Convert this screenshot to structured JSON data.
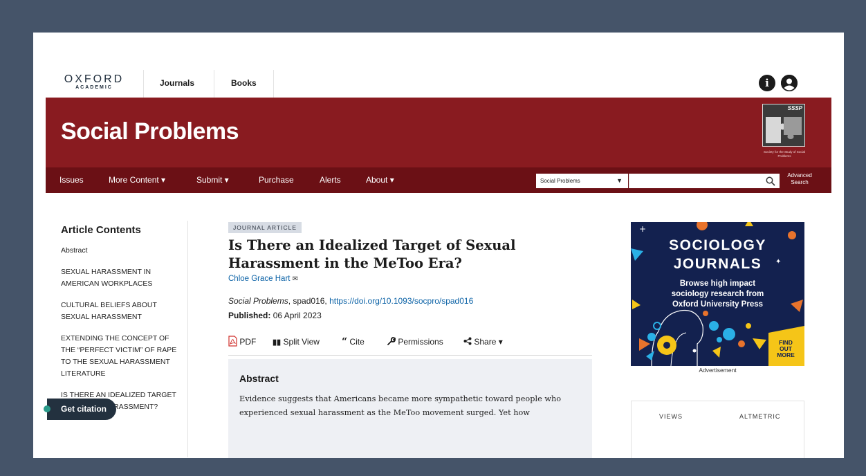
{
  "header": {
    "logo_line1": "OXFORD",
    "logo_line2": "ACADEMIC",
    "tabs": [
      {
        "label": "Journals"
      },
      {
        "label": "Books"
      }
    ],
    "info_icon": "info-icon",
    "account_icon": "account-icon"
  },
  "banner": {
    "journal_title": "Social Problems",
    "society_logo_text": "SSSP",
    "society_caption": "Society for the Study of Social Problems",
    "color": "#891b20"
  },
  "nav": {
    "items": [
      {
        "label": "Issues"
      },
      {
        "label": "More Content ▾"
      },
      {
        "label": "Submit ▾"
      },
      {
        "label": "Purchase"
      },
      {
        "label": "Alerts"
      },
      {
        "label": "About ▾"
      }
    ],
    "search_scope": "Social Problems",
    "search_placeholder": "",
    "advanced_search": "Advanced Search",
    "color": "#6b1015"
  },
  "sidebar": {
    "title": "Article Contents",
    "items": [
      {
        "label": "Abstract"
      },
      {
        "label": "SEXUAL HARASSMENT IN AMERICAN WORKPLACES"
      },
      {
        "label": "CULTURAL BELIEFS ABOUT SEXUAL HARASSMENT"
      },
      {
        "label": "EXTENDING THE CONCEPT OF THE “PERFECT VICTIM” OF RAPE TO THE SEXUAL HARASSMENT LITERATURE"
      },
      {
        "label": "IS THERE AN IDEALIZED TARGET OF SEXUAL HARASSMENT?"
      }
    ],
    "get_citation": "Get citation"
  },
  "article": {
    "badge": "JOURNAL ARTICLE",
    "title": "Is There an Idealized Target of Sexual Harassment in the MeToo Era?",
    "author": "Chloe Grace Hart",
    "journal": "Social Problems",
    "article_id": ", spad016, ",
    "doi": "https://doi.org/10.1093/socpro/spad016",
    "published_label": "Published:",
    "published_date": "06 April 2023",
    "tools": [
      {
        "label": "PDF"
      },
      {
        "label": "Split View"
      },
      {
        "label": "Cite"
      },
      {
        "label": "Permissions"
      },
      {
        "label": "Share ▾"
      }
    ],
    "abstract_title": "Abstract",
    "abstract_text": "Evidence suggests that Americans became more sympathetic toward people who experienced sexual harassment as the MeToo movement surged. Yet how"
  },
  "ad": {
    "heading_line1": "SOCIOLOGY",
    "heading_line2": "JOURNALS",
    "subtext": "Browse high impact sociology research from Oxford University Press",
    "cta_line1": "FIND",
    "cta_line2": "OUT",
    "cta_line3": "MORE",
    "label": "Advertisement",
    "bg_color": "#13214f",
    "accent_color": "#f5c518"
  },
  "metrics": {
    "views_label": "VIEWS",
    "altmetric_label": "ALTMETRIC"
  }
}
